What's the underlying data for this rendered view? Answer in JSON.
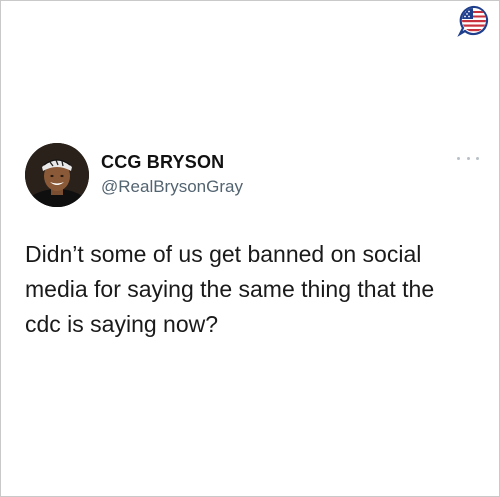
{
  "tweet": {
    "display_name": "CCG BRYSON",
    "handle": "@RealBrysonGray",
    "text": "Didn’t some of us get banned on social media for saying the same thing that the cdc is saying now?"
  },
  "icons": {
    "corner_logo": "american-flag-speech-bubble-icon",
    "more": "more-options-icon"
  },
  "colors": {
    "text": "#1a1a1a",
    "handle": "#536471",
    "flag_red": "#c8323c",
    "flag_blue": "#1f3f8c"
  }
}
